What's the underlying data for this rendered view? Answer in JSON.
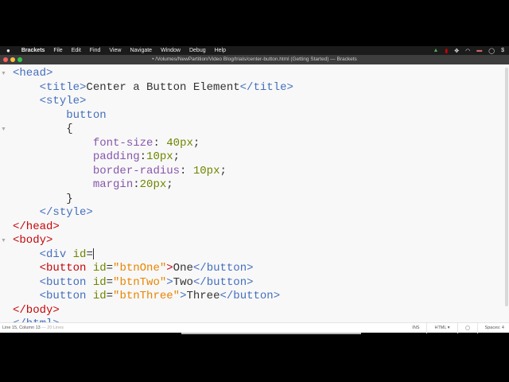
{
  "menubar": {
    "apple": "",
    "app": "Brackets",
    "items": [
      "File",
      "Edit",
      "Find",
      "View",
      "Navigate",
      "Window",
      "Debug",
      "Help"
    ]
  },
  "titlebar": {
    "title": "• /Volumes/NewPartition/Video Blog/trials/center-button.html (Getting Started) — Brackets"
  },
  "colors": {
    "tag": "#446fbd",
    "attr": "#6d8600",
    "string": "#e88501",
    "property": "#8757ad",
    "error": "#c5060b"
  },
  "code": {
    "lines": [
      {
        "fold": true,
        "tokens": [
          [
            "tag",
            "<head>"
          ]
        ]
      },
      {
        "tokens": [
          [
            "txt",
            "    "
          ],
          [
            "tag",
            "<title>"
          ],
          [
            "txt",
            "Center a Button Element"
          ],
          [
            "tag",
            "</title>"
          ]
        ]
      },
      {
        "tokens": [
          [
            "txt",
            "    "
          ],
          [
            "tag",
            "<style>"
          ]
        ]
      },
      {
        "tokens": [
          [
            "txt",
            "        "
          ],
          [
            "tag",
            "button"
          ]
        ]
      },
      {
        "fold": true,
        "tokens": [
          [
            "txt",
            "        {"
          ]
        ]
      },
      {
        "tokens": [
          [
            "txt",
            "            "
          ],
          [
            "prop",
            "font-size"
          ],
          [
            "txt",
            ": "
          ],
          [
            "num",
            "40px"
          ],
          [
            "txt",
            ";"
          ]
        ]
      },
      {
        "tokens": [
          [
            "txt",
            "            "
          ],
          [
            "prop",
            "padding"
          ],
          [
            "txt",
            ":"
          ],
          [
            "num",
            "10px"
          ],
          [
            "txt",
            ";"
          ]
        ]
      },
      {
        "tokens": [
          [
            "txt",
            "            "
          ],
          [
            "prop",
            "border-radius"
          ],
          [
            "txt",
            ": "
          ],
          [
            "num",
            "10px"
          ],
          [
            "txt",
            ";"
          ]
        ]
      },
      {
        "tokens": [
          [
            "txt",
            "            "
          ],
          [
            "prop",
            "margin"
          ],
          [
            "txt",
            ":"
          ],
          [
            "num",
            "20px"
          ],
          [
            "txt",
            ";"
          ]
        ]
      },
      {
        "tokens": [
          [
            "txt",
            "        }"
          ]
        ]
      },
      {
        "tokens": [
          [
            "txt",
            "    "
          ],
          [
            "tag",
            "</style>"
          ]
        ]
      },
      {
        "tokens": [
          [
            "err",
            "</head>"
          ]
        ]
      },
      {
        "fold": true,
        "tokens": [
          [
            "err",
            "<body>"
          ]
        ]
      },
      {
        "cursor": true,
        "tokens": [
          [
            "txt",
            "    "
          ],
          [
            "tag",
            "<div "
          ],
          [
            "attr",
            "id"
          ],
          [
            "txt",
            "="
          ]
        ]
      },
      {
        "tokens": [
          [
            "txt",
            "    "
          ],
          [
            "err",
            "<button "
          ],
          [
            "attr",
            "id"
          ],
          [
            "txt",
            "="
          ],
          [
            "str",
            "\"btnOne\""
          ],
          [
            "err",
            ">"
          ],
          [
            "txt",
            "One"
          ],
          [
            "tag",
            "</button>"
          ]
        ]
      },
      {
        "tokens": [
          [
            "txt",
            "    "
          ],
          [
            "tag",
            "<button "
          ],
          [
            "attr",
            "id"
          ],
          [
            "txt",
            "="
          ],
          [
            "str",
            "\"btnTwo\""
          ],
          [
            "tag",
            ">"
          ],
          [
            "txt",
            "Two"
          ],
          [
            "tag",
            "</button>"
          ]
        ]
      },
      {
        "tokens": [
          [
            "txt",
            "    "
          ],
          [
            "tag",
            "<button "
          ],
          [
            "attr",
            "id"
          ],
          [
            "txt",
            "="
          ],
          [
            "str",
            "\"btnThree\""
          ],
          [
            "tag",
            ">"
          ],
          [
            "txt",
            "Three"
          ],
          [
            "tag",
            "</button>"
          ]
        ]
      },
      {
        "tokens": [
          [
            "err",
            "</body>"
          ]
        ]
      },
      {
        "tokens": [
          [
            "tag",
            "</html>"
          ]
        ]
      }
    ]
  },
  "statusbar": {
    "position": "Line 15, Column 13",
    "lines": " — 20 Lines",
    "mode": "INS",
    "language": "HTML ▾",
    "spaces": "Spaces: 4"
  }
}
